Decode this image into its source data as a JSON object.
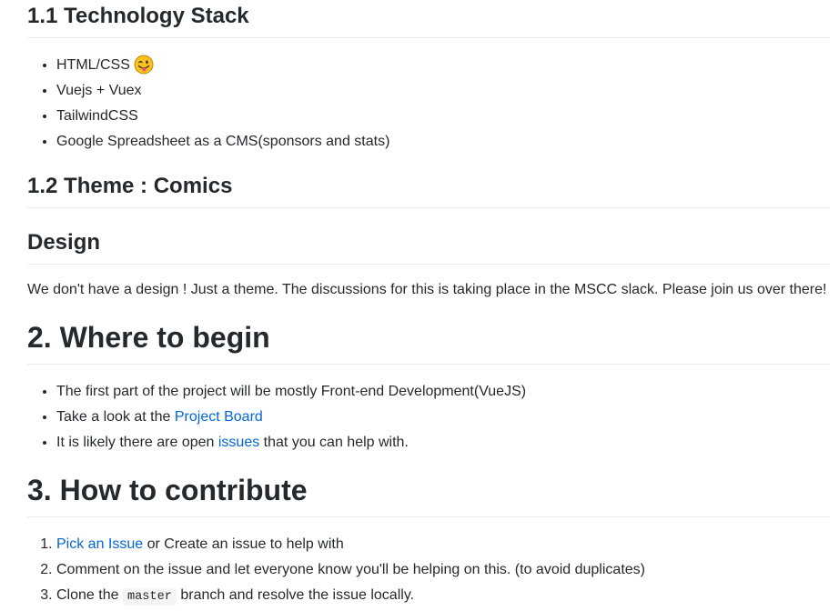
{
  "sections": {
    "tech_stack": {
      "heading": "1.1 Technology Stack",
      "items": [
        "HTML/CSS",
        "Vuejs + Vuex",
        "TailwindCSS",
        "Google Spreadsheet as a CMS(sponsors and stats)"
      ],
      "emoji_icon": "winking-face-with-tongue-icon"
    },
    "theme": {
      "heading": "1.2 Theme : Comics"
    },
    "design": {
      "heading": "Design",
      "paragraph": "We don't have a design ! Just a theme. The discussions for this is taking place in the MSCC slack. Please join us over there!"
    },
    "where_to_begin": {
      "heading": "2. Where to begin",
      "item1": "The first part of the project will be mostly Front-end Development(VueJS)",
      "item2_prefix": "Take a look at the ",
      "item2_link": "Project Board",
      "item3_prefix": "It is likely there are open ",
      "item3_link": "issues",
      "item3_suffix": " that you can help with."
    },
    "how_to_contribute": {
      "heading": "3. How to contribute",
      "step1_link": "Pick an Issue",
      "step1_suffix": " or Create an issue to help with",
      "step2": "Comment on the issue and let everyone know you'll be helping on this. (to avoid duplicates)",
      "step3_prefix": "Clone the ",
      "step3_code": "master",
      "step3_suffix": " branch and resolve the issue locally."
    }
  },
  "colors": {
    "link": "#0366d6",
    "text": "#24292e",
    "rule": "#eaecef"
  }
}
